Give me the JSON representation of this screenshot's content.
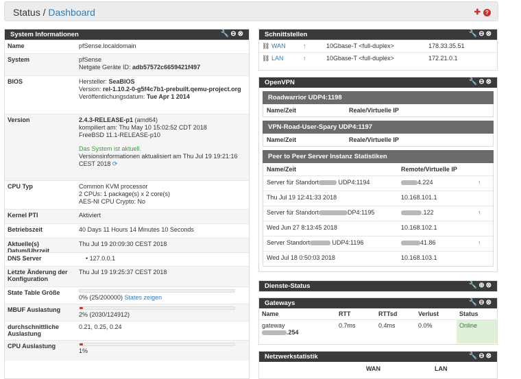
{
  "header": {
    "title": "Status /",
    "crumb": "Dashboard",
    "add": "✚",
    "help": "?"
  },
  "panel_icons": {
    "wrench": "🔧",
    "min": "⊖",
    "close": "⊗",
    "add": "⊕"
  },
  "sysinfo": {
    "title": "System Informationen",
    "name_k": "Name",
    "name_v": "pfSense.localdomain",
    "system_k": "System",
    "system_v1": "pfSense",
    "system_v2": "Netgate Geräte ID: ",
    "system_id": "adb57572c6659421f497",
    "bios_k": "BIOS",
    "bios_v1": "Hersteller: ",
    "bios_vendor": "SeaBIOS",
    "bios_v2": "Version: ",
    "bios_ver": "rel-1.10.2-0-g5f4c7b1-prebuilt.qemu-project.org",
    "bios_v3": "Veröffentlichungsdatum: ",
    "bios_date": "Tue Apr 1 2014",
    "ver_k": "Version",
    "ver_v1": "2.4.3-RELEASE-p1",
    "ver_v1b": " (amd64)",
    "ver_v2": "kompiliert am: Thu May 10 15:02:52 CDT 2018",
    "ver_v3": "FreeBSD 11.1-RELEASE-p10",
    "ver_v4": "Das System ist aktuell.",
    "ver_v5": "Versionsinformationen aktualisiert am Thu Jul 19 19:21:16 CEST 2018",
    "cpu_k": "CPU Typ",
    "cpu_v1": "Common KVM processor",
    "cpu_v2": "2 CPUs: 1 package(s) x 2 core(s)",
    "cpu_v3": "AES-NI CPU Crypto: No",
    "pti_k": "Kernel PTI",
    "pti_v": "Aktiviert",
    "up_k": "Betriebszeit",
    "up_v": "40 Days 11 Hours 14 Minutes 10 Seconds",
    "dt_k": "Aktuelle(s) Datum/Uhrzeit",
    "dt_v": "Thu Jul 19 20:09:30 CEST 2018",
    "dns_k": "DNS Server",
    "dns_v": "127.0.0.1",
    "lc_k": "Letzte Änderung der Konfiguration",
    "lc_v": "Thu Jul 19 19:25:37 CEST 2018",
    "st_k": "State Table Größe",
    "st_v": "0% (25/200000) ",
    "st_link": "States zeigen",
    "st_frac": 0.0,
    "mb_k": "MBUF Auslastung",
    "mb_v": "2% (2030/124912)",
    "mb_frac": 0.02,
    "la_k": "durchschnittliche Auslastung",
    "la_v": "0.21, 0.25, 0.24",
    "cu_k": "CPU Auslastung",
    "cu_v": "1%",
    "cu_frac": 0.01
  },
  "ifaces": {
    "title": "Schnittstellen",
    "rows": [
      {
        "name": "WAN",
        "media": "10Gbase-T <full-duplex>",
        "ip": "178.33.35.51"
      },
      {
        "name": "LAN",
        "media": "10Gbase-T <full-duplex>",
        "ip": "172.21.0.1"
      }
    ]
  },
  "openvpn": {
    "title": "OpenVPN",
    "s1": "Roadwarrior UDP4:1198",
    "s2": "VPN-Road-User-Spary UDP4:1197",
    "c1": "Name/Zeit",
    "c2": "Reale/Virtuelle IP",
    "s3": "Peer to Peer Server Instanz Statistiken",
    "c3": "Remote/Virtuelle IP",
    "p2p": [
      {
        "a": "Server für Standort",
        "a2": " UDP4:1194",
        "b": "4.224",
        "up": true
      },
      {
        "a": "Thu Jul 19 12:41:33 2018",
        "b": "10.168.101.1"
      },
      {
        "a": "Server für Standort",
        "a2": "DP4:1195",
        "b": ".122",
        "up": true
      },
      {
        "a": "Wed Jun 27 8:13:45 2018",
        "b": "10.168.102.1"
      },
      {
        "a": "Server Standort",
        "a2": " UDP4:1196",
        "b": "41.86",
        "up": true
      },
      {
        "a": "Wed Jul 18 0:50:03 2018",
        "b": "10.168.103.1"
      }
    ]
  },
  "dienste": {
    "title": "Dienste-Status"
  },
  "gateways": {
    "title": "Gateways",
    "h": [
      "Name",
      "RTT",
      "RTTsd",
      "Verlust",
      "Status"
    ],
    "gw": "gateway",
    "ip": ".254",
    "rtt": "0.7ms",
    "rttsd": "0.4ms",
    "loss": "0.0%",
    "status": "Online"
  },
  "netstat": {
    "title": "Netzwerkstatistik",
    "wan": "WAN",
    "lan": "LAN"
  }
}
